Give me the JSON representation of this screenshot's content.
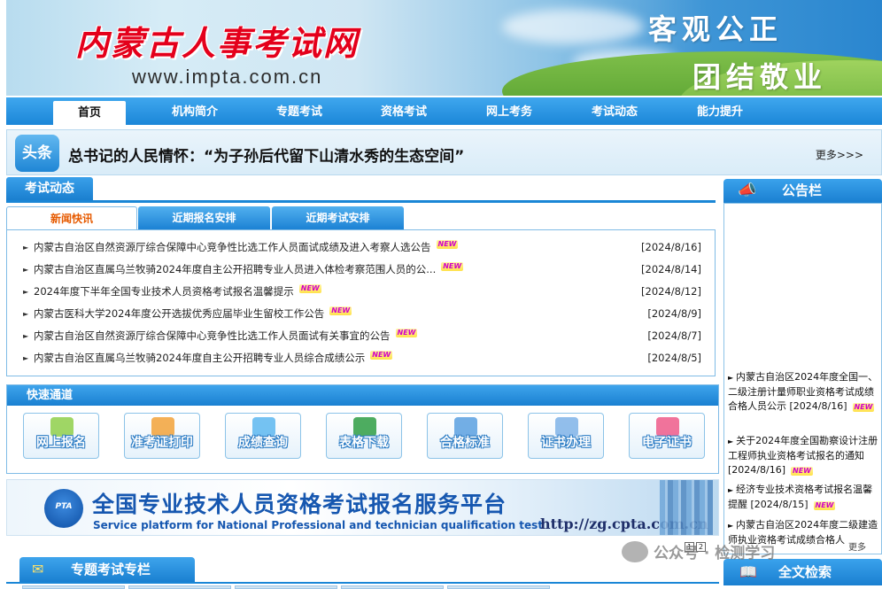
{
  "header": {
    "site_title": "内蒙古人事考试网",
    "site_url": "www.impta.com.cn",
    "slogan_line1": "客观公正",
    "slogan_line2": "团结敬业"
  },
  "nav": {
    "items": [
      {
        "label": "首页",
        "active": true
      },
      {
        "label": "机构简介"
      },
      {
        "label": "专题考试"
      },
      {
        "label": "资格考试"
      },
      {
        "label": "网上考务"
      },
      {
        "label": "考试动态"
      },
      {
        "label": "能力提升"
      }
    ]
  },
  "headline": {
    "badge": "头条",
    "text": "总书记的人民情怀：“为子孙后代留下山清水秀的生态空间”",
    "more": "更多>>>"
  },
  "exam_news": {
    "section_title": "考试动态",
    "tabs": [
      "新闻快讯",
      "近期报名安排",
      "近期考试安排"
    ],
    "active_tab": 0,
    "new_tag": "NEW",
    "items": [
      {
        "title": "内蒙古自治区自然资源厅综合保障中心竞争性比选工作人员面试成绩及进入考察人选公告",
        "date": "[2024/8/16]"
      },
      {
        "title": "内蒙古自治区直属乌兰牧骑2024年度自主公开招聘专业人员进入体检考察范围人员的公...",
        "date": "[2024/8/14]"
      },
      {
        "title": "2024年度下半年全国专业技术人员资格考试报名温馨提示",
        "date": "[2024/8/12]"
      },
      {
        "title": "内蒙古医科大学2024年度公开选拔优秀应届毕业生留校工作公告",
        "date": "[2024/8/9]"
      },
      {
        "title": "内蒙古自治区自然资源厅综合保障中心竞争性比选工作人员面试有关事宜的公告",
        "date": "[2024/8/7]"
      },
      {
        "title": "内蒙古自治区直属乌兰牧骑2024年度自主公开招聘专业人员综合成绩公示",
        "date": "[2024/8/5]"
      }
    ]
  },
  "quick": {
    "title": "快速通道",
    "buttons": [
      {
        "label": "网上报名",
        "color": "#8fcf4a"
      },
      {
        "label": "准考证打印",
        "color": "#f2a23a"
      },
      {
        "label": "成绩查询",
        "color": "#5db7f0"
      },
      {
        "label": "表格下载",
        "color": "#2f9e44"
      },
      {
        "label": "合格标准",
        "color": "#5aa0e0"
      },
      {
        "label": "证书办理",
        "color": "#7fb3e8"
      },
      {
        "label": "电子证书",
        "color": "#ee5a8a"
      }
    ]
  },
  "platform": {
    "logo_text": "PTA",
    "title_cn": "全国专业技术人员资格考试报名服务平台",
    "title_en": "Service platform for National Professional and technician qualification test",
    "url": "http://zg.cpta.com.cn"
  },
  "special": {
    "title": "专题考试专栏"
  },
  "notice": {
    "title": "公告栏",
    "items": [
      {
        "text": "内蒙古自治区2024年度全国一、二级注册计量师职业资格考试成绩合格人员公示",
        "date": "[2024/8/16]"
      },
      {
        "text": "关于2024年度全国勘察设计注册工程师执业资格考试报名的通知",
        "date": "[2024/8/16]"
      },
      {
        "text": "经济专业技术资格考试报名温馨提醒",
        "date": "[2024/8/15]"
      },
      {
        "text": "内蒙古自治区2024年度二级建造师执业资格考试成绩合格人",
        "date": ""
      }
    ],
    "pages": [
      "1",
      "2"
    ],
    "more": "更多"
  },
  "search": {
    "title": "全文检索"
  },
  "watermark": {
    "text": "公众号 · 检测学习"
  },
  "colors": {
    "brand_blue": "#1a86d6",
    "title_red": "#e4001b",
    "active_tab_orange": "#e65a00",
    "new_tag": "#d100c8"
  }
}
